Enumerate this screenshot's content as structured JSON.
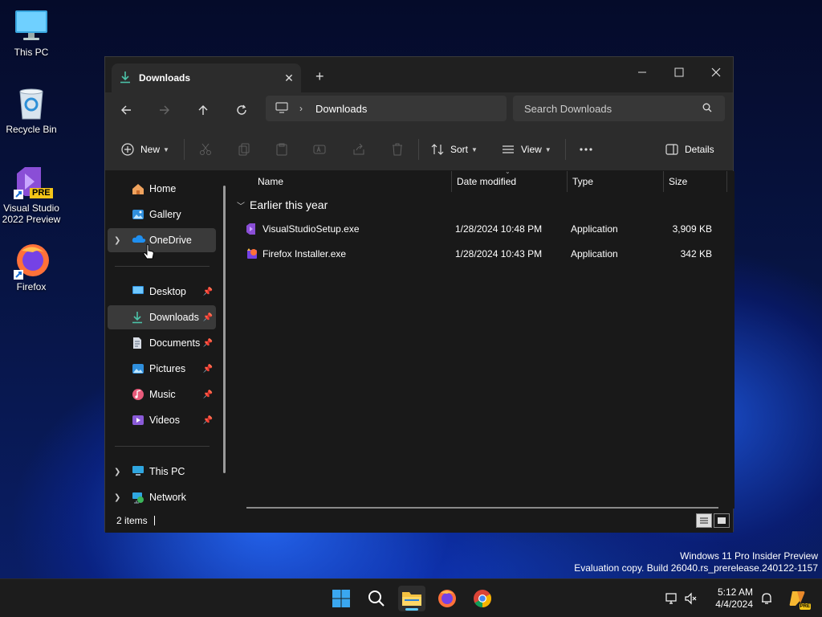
{
  "desktop": {
    "icons": [
      {
        "label": "This PC",
        "icon": "monitor-icon"
      },
      {
        "label": "Recycle Bin",
        "icon": "recycle-bin-icon"
      },
      {
        "label": "Visual Studio 2022 Preview",
        "label_line1": "Visual Studio",
        "label_line2": "2022 Preview",
        "badge": "PRE",
        "icon": "visual-studio-icon"
      },
      {
        "label": "Firefox",
        "icon": "firefox-icon"
      }
    ]
  },
  "window": {
    "tab_title": "Downloads",
    "address": {
      "crumb": "Downloads"
    },
    "search": {
      "placeholder": "Search Downloads"
    },
    "commands": {
      "new": "New",
      "sort": "Sort",
      "view": "View",
      "details": "Details"
    },
    "sidebar": {
      "items": [
        {
          "label": "Home"
        },
        {
          "label": "Gallery"
        },
        {
          "label": "OneDrive"
        },
        {
          "label": "Desktop"
        },
        {
          "label": "Downloads"
        },
        {
          "label": "Documents"
        },
        {
          "label": "Pictures"
        },
        {
          "label": "Music"
        },
        {
          "label": "Videos"
        },
        {
          "label": "This PC"
        },
        {
          "label": "Network"
        }
      ]
    },
    "columns": {
      "name": "Name",
      "date": "Date modified",
      "type": "Type",
      "size": "Size"
    },
    "group_label": "Earlier this year",
    "files": [
      {
        "name": "VisualStudioSetup.exe",
        "date": "1/28/2024 10:48 PM",
        "type": "Application",
        "size": "3,909 KB"
      },
      {
        "name": "Firefox Installer.exe",
        "date": "1/28/2024 10:43 PM",
        "type": "Application",
        "size": "342 KB"
      }
    ],
    "status": "2 items"
  },
  "watermark": {
    "line1": "Windows 11 Pro Insider Preview",
    "line2": "Evaluation copy. Build 26040.rs_prerelease.240122-1157"
  },
  "taskbar": {
    "time": "5:12 AM",
    "date": "4/4/2024",
    "tray_badge": "PRE"
  }
}
